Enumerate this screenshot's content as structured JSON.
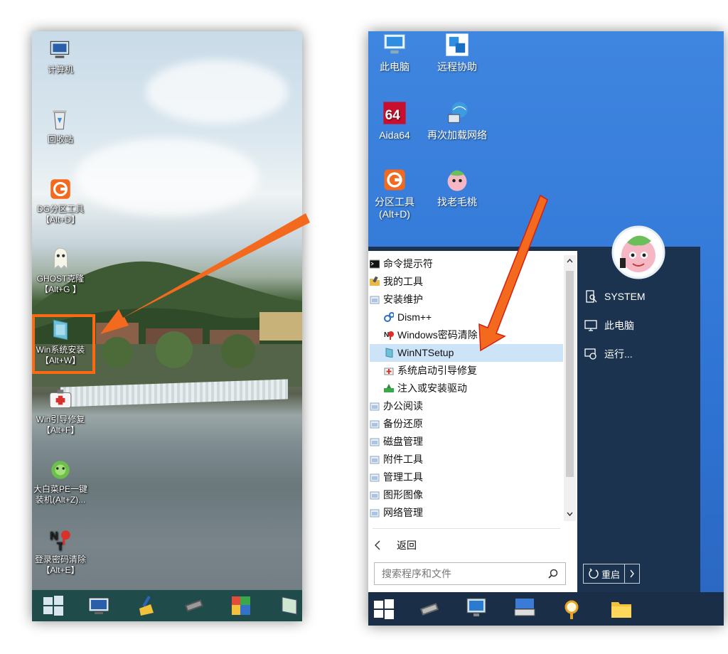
{
  "left_desktop": {
    "icons": [
      {
        "label": "计算机",
        "icon": "computer-icon"
      },
      {
        "label": "回收站",
        "icon": "recycle-bin-icon"
      },
      {
        "label": "DG分区工具\n【Alt+D】",
        "icon": "diskgenius-icon"
      },
      {
        "label": "GHOST克隆\n【Alt+G 】",
        "icon": "ghost-icon"
      },
      {
        "label": "Win系统安装\n【Alt+W】",
        "icon": "win-setup-icon"
      },
      {
        "label": "Win引导修复\n【Alt+F】",
        "icon": "boot-repair-icon"
      },
      {
        "label": "大白菜PE一键\n装机(Alt+Z)...",
        "icon": "cabbage-icon"
      },
      {
        "label": "登录密码清除\n【Alt+E】",
        "icon": "password-clear-icon"
      }
    ],
    "taskbar_icons": [
      "start-icon",
      "monitor-icon",
      "broom-icon",
      "chip-icon",
      "puzzle-icon",
      "notebook-icon"
    ]
  },
  "right_desktop": {
    "icons": [
      {
        "label": "此电脑",
        "icon": "this-pc-icon"
      },
      {
        "label": "远程协助",
        "icon": "remote-assist-icon"
      },
      {
        "label": "Aida64",
        "icon": "aida64-icon"
      },
      {
        "label": "再次加载网络",
        "icon": "reload-network-icon"
      },
      {
        "label": "分区工具\n(Alt+D)",
        "icon": "partition-tool-icon"
      },
      {
        "label": "找老毛桃",
        "icon": "peach-icon"
      }
    ]
  },
  "start_menu": {
    "items": [
      {
        "label": "命令提示符",
        "icon": "cmd-icon",
        "sub": false,
        "highlight": false
      },
      {
        "label": "我的工具",
        "icon": "tools-folder-icon",
        "sub": false,
        "highlight": false
      },
      {
        "label": "安装维护",
        "icon": "folder-icon",
        "sub": false,
        "highlight": false
      },
      {
        "label": "Dism++",
        "icon": "gears-icon",
        "sub": true,
        "highlight": false
      },
      {
        "label": "Windows密码清除",
        "icon": "key-icon",
        "sub": true,
        "highlight": false
      },
      {
        "label": "WinNTSetup",
        "icon": "setup-icon",
        "sub": true,
        "highlight": true
      },
      {
        "label": "系统启动引导修复",
        "icon": "medkit-icon",
        "sub": true,
        "highlight": false
      },
      {
        "label": "注入或安装驱动",
        "icon": "driver-icon",
        "sub": true,
        "highlight": false
      },
      {
        "label": "办公阅读",
        "icon": "folder-icon",
        "sub": false,
        "highlight": false
      },
      {
        "label": "备份还原",
        "icon": "folder-icon",
        "sub": false,
        "highlight": false
      },
      {
        "label": "磁盘管理",
        "icon": "folder-icon",
        "sub": false,
        "highlight": false
      },
      {
        "label": "附件工具",
        "icon": "folder-icon",
        "sub": false,
        "highlight": false
      },
      {
        "label": "管理工具",
        "icon": "folder-icon",
        "sub": false,
        "highlight": false
      },
      {
        "label": "图形图像",
        "icon": "folder-icon",
        "sub": false,
        "highlight": false
      },
      {
        "label": "网络管理",
        "icon": "folder-icon",
        "sub": false,
        "highlight": false
      }
    ],
    "back_label": "返回",
    "search_placeholder": "搜索程序和文件",
    "sidebar": {
      "user": "SYSTEM",
      "this_pc": "此电脑",
      "run": "运行...",
      "restart": "重启"
    }
  },
  "colors": {
    "highlight_box": "#ff6a10",
    "arrow": "#f36a1e",
    "menu_highlight": "#cde3f8",
    "start_sidebar": "#1c3350"
  }
}
